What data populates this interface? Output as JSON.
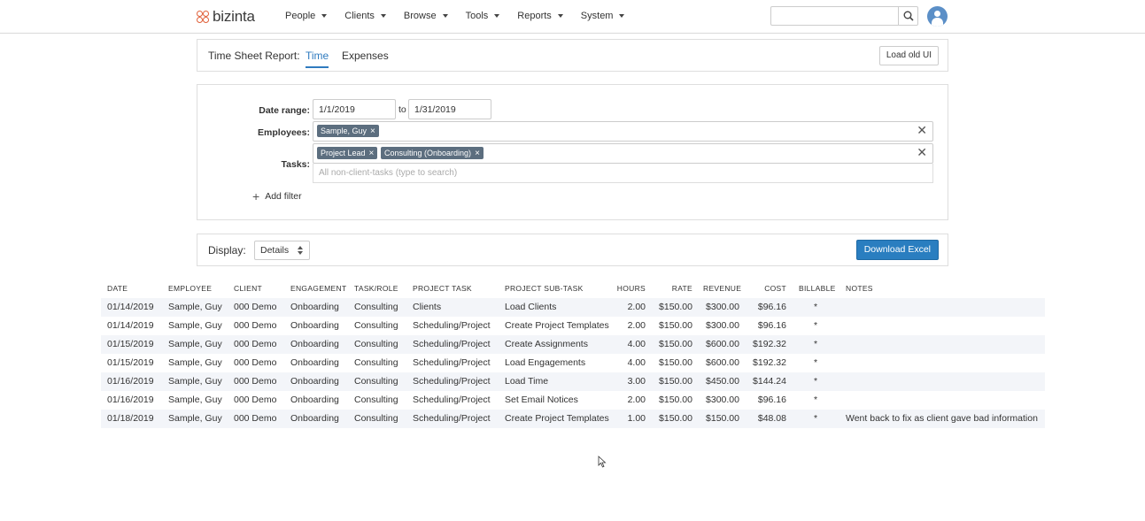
{
  "nav": {
    "logo": "bizinta",
    "menu": [
      "People",
      "Clients",
      "Browse",
      "Tools",
      "Reports",
      "System"
    ],
    "search_placeholder": "",
    "brand_color": "#e0603a"
  },
  "report_header": {
    "title": "Time Sheet Report:",
    "tabs": [
      "Time",
      "Expenses"
    ],
    "active_tab": "Time",
    "load_old_ui": "Load old UI"
  },
  "filters": {
    "date_range_label": "Date range:",
    "date_from": "1/1/2019",
    "to_label": "to",
    "date_to": "1/31/2019",
    "employees_label": "Employees:",
    "employees": [
      "Sample, Guy"
    ],
    "tasks_label": "Tasks:",
    "tasks": [
      "Project Lead",
      "Consulting (Onboarding)"
    ],
    "tasks_placeholder": "All non-client-tasks (type to search)",
    "clear": "✕",
    "tag_remove": "×",
    "add_filter": "Add filter"
  },
  "display": {
    "label": "Display:",
    "selected": "Details",
    "download": "Download Excel"
  },
  "table": {
    "columns": [
      "Date",
      "Employee",
      "Client",
      "Engagement",
      "Task/Role",
      "Project Task",
      "Project Sub-task",
      "Hours",
      "Rate",
      "Revenue",
      "Cost",
      "Billable",
      "Notes"
    ],
    "rows": [
      [
        "01/14/2019",
        "Sample, Guy",
        "000 Demo",
        "Onboarding",
        "Consulting",
        "Clients",
        "Load Clients",
        "2.00",
        "$150.00",
        "$300.00",
        "$96.16",
        "*",
        ""
      ],
      [
        "01/14/2019",
        "Sample, Guy",
        "000 Demo",
        "Onboarding",
        "Consulting",
        "Scheduling/Project",
        "Create Project Templates",
        "2.00",
        "$150.00",
        "$300.00",
        "$96.16",
        "*",
        ""
      ],
      [
        "01/15/2019",
        "Sample, Guy",
        "000 Demo",
        "Onboarding",
        "Consulting",
        "Scheduling/Project",
        "Create Assignments",
        "4.00",
        "$150.00",
        "$600.00",
        "$192.32",
        "*",
        ""
      ],
      [
        "01/15/2019",
        "Sample, Guy",
        "000 Demo",
        "Onboarding",
        "Consulting",
        "Scheduling/Project",
        "Load Engagements",
        "4.00",
        "$150.00",
        "$600.00",
        "$192.32",
        "*",
        ""
      ],
      [
        "01/16/2019",
        "Sample, Guy",
        "000 Demo",
        "Onboarding",
        "Consulting",
        "Scheduling/Project",
        "Load Time",
        "3.00",
        "$150.00",
        "$450.00",
        "$144.24",
        "*",
        ""
      ],
      [
        "01/16/2019",
        "Sample, Guy",
        "000 Demo",
        "Onboarding",
        "Consulting",
        "Scheduling/Project",
        "Set Email Notices",
        "2.00",
        "$150.00",
        "$300.00",
        "$96.16",
        "*",
        ""
      ],
      [
        "01/18/2019",
        "Sample, Guy",
        "000 Demo",
        "Onboarding",
        "Consulting",
        "Scheduling/Project",
        "Create Project Templates",
        "1.00",
        "$150.00",
        "$150.00",
        "$48.08",
        "*",
        "Went back to fix as client gave bad information"
      ]
    ]
  }
}
